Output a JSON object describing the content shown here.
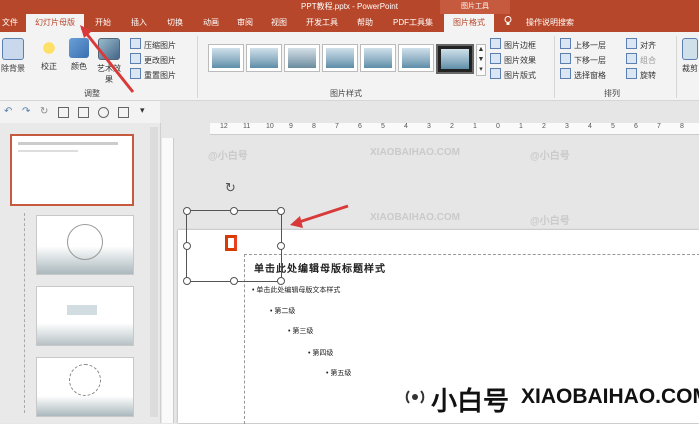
{
  "window": {
    "title": "PPT教程.pptx  -  PowerPoint",
    "context_group": "图片工具"
  },
  "tabs": [
    {
      "label": "文件"
    },
    {
      "label": "幻灯片母版"
    },
    {
      "label": "开始"
    },
    {
      "label": "插入"
    },
    {
      "label": "切换"
    },
    {
      "label": "动画"
    },
    {
      "label": "审阅"
    },
    {
      "label": "视图"
    },
    {
      "label": "开发工具"
    },
    {
      "label": "帮助"
    },
    {
      "label": "PDF工具集"
    },
    {
      "label": "图片格式"
    },
    {
      "label": "操作说明搜索"
    }
  ],
  "ribbon": {
    "remove_bg": "除背景",
    "correct": "校正",
    "color": "颜色",
    "art_effect": "艺术效果",
    "compress": "压缩图片",
    "change": "更改图片",
    "reset": "重置图片",
    "group_adjust": "调整",
    "group_styles": "图片样式",
    "border": "图片边框",
    "effect": "图片效果",
    "layout": "图片版式",
    "bring_forward": "上移一层",
    "send_backward": "下移一层",
    "selection_pane": "选择窗格",
    "align": "对齐",
    "group": "组合",
    "rotate": "旋转",
    "group_arrange": "排列",
    "crop": "裁剪"
  },
  "ruler": {
    "labels": [
      "12",
      "11",
      "10",
      "9",
      "8",
      "7",
      "6",
      "5",
      "4",
      "3",
      "2",
      "1",
      "0",
      "1",
      "2",
      "3",
      "4",
      "5",
      "6",
      "7",
      "8"
    ]
  },
  "slide": {
    "title": "单击此处编辑母版标题样式",
    "levels": [
      "单击此处编辑母版文本样式",
      "第二级",
      "第三级",
      "第四级",
      "第五级"
    ]
  },
  "watermark": {
    "text": "XIAOBAIHAO.COM",
    "handle": "@小白号"
  },
  "brand": {
    "name": "小白号",
    "site": "XIAOBAIHAO.COM"
  },
  "colors": {
    "accent": "#b7472a",
    "arrow": "#d83a3a"
  }
}
